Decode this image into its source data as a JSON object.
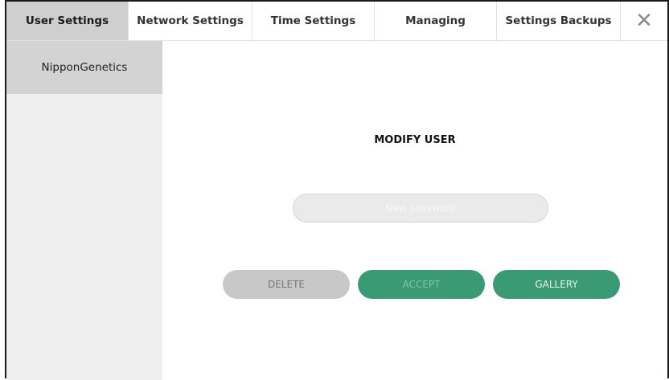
{
  "tabs": [
    {
      "label": "User Settings",
      "active": true
    },
    {
      "label": "Network Settings",
      "active": false
    },
    {
      "label": "Time Settings",
      "active": false
    },
    {
      "label": "Managing",
      "active": false
    },
    {
      "label": "Settings Backups",
      "active": false
    }
  ],
  "close_glyph": "✕",
  "sidebar": {
    "items": [
      {
        "label": "NipponGenetics",
        "selected": true
      }
    ]
  },
  "main": {
    "title": "MODIFY USER",
    "password_placeholder": "New password",
    "buttons": {
      "delete": "DELETE",
      "accept": "ACCEPT",
      "gallery": "GALLERY"
    }
  },
  "colors": {
    "active_tab": "#cfcfcf",
    "sidebar_selected": "#d3d3d3",
    "sidebar_bg": "#efefef",
    "accent_green": "#399a74",
    "disabled_gray": "#c8c8c8"
  }
}
